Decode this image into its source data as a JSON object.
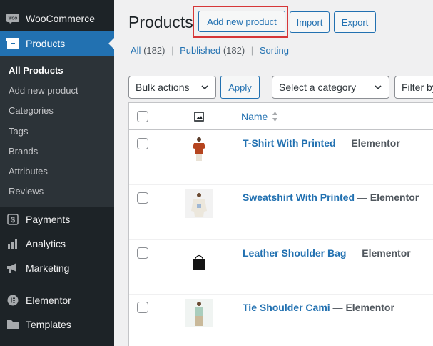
{
  "sidebar": {
    "woocommerce": "WooCommerce",
    "woo_logo_text": "WOO",
    "products": "Products",
    "submenu": [
      "All Products",
      "Add new product",
      "Categories",
      "Tags",
      "Brands",
      "Attributes",
      "Reviews"
    ],
    "payments": "Payments",
    "analytics": "Analytics",
    "marketing": "Marketing",
    "elementor": "Elementor",
    "templates": "Templates"
  },
  "header": {
    "title": "Products",
    "add_new": "Add new product",
    "import": "Import",
    "export": "Export"
  },
  "filters": {
    "all": "All",
    "all_count": "(182)",
    "published": "Published",
    "published_count": "(182)",
    "sorting": "Sorting",
    "separator": "|"
  },
  "toolbar": {
    "bulk_actions": "Bulk actions",
    "apply": "Apply",
    "category": "Select a category",
    "filter_partial": "Filter by"
  },
  "table": {
    "name_header": "Name",
    "rows": [
      {
        "name": "T-Shirt With Printed",
        "dash": " — ",
        "state": "Elementor"
      },
      {
        "name": "Sweatshirt With Printed",
        "dash": " — ",
        "state": "Elementor"
      },
      {
        "name": "Leather Shoulder Bag",
        "dash": " — ",
        "state": "Elementor"
      },
      {
        "name": "Tie Shoulder Cami",
        "dash": " — ",
        "state": "Elementor"
      }
    ]
  },
  "colors": {
    "sidebar_bg": "#1d2327",
    "submenu_bg": "#2c3338",
    "accent": "#2271b1",
    "highlight": "#d63638"
  }
}
